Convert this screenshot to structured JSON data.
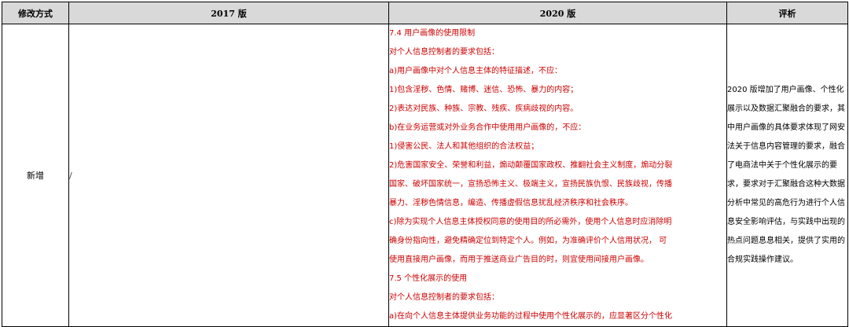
{
  "table": {
    "headers": {
      "method": "修改方式",
      "v2017": "2017 版",
      "v2020": "2020 版",
      "comment": "评析"
    },
    "row": {
      "method": "新增",
      "v2017": "/",
      "v2020_lines": [
        "7.4 用户画像的使用限制",
        "对个人信息控制者的要求包括：",
        "a)用户画像中对个人信息主体的特征描述，不应：",
        "1)包含淫秽、色情、赌博、迷信、恐怖、暴力的内容；",
        "2)表达对民族、种族、宗教、残疾、疾病歧视的内容。",
        "b)在业务运营或对外业务合作中使用用户画像的，不应：",
        "1)侵害公民、法人和其他组织的合法权益；",
        "2)危害国家安全、荣誉和利益，煽动颠覆国家政权、推翻社会主义制度，煽动分裂",
        "国家、破坏国家统一，宣扬恐怖主义、极端主义，宣扬民族仇恨、民族歧视，传播",
        "暴力、淫秽色情信息，编造、传播虚假信息扰乱经济秩序和社会秩序。",
        "c)除为实现个人信息主体授权同意的使用目的所必需外，使用个人信息时应消除明",
        "确身份指向性，避免精确定位到特定个人。例如，为准确评价个人信用状况， 可",
        "使用直接用户画像，而用于推送商业广告目的时，则宜使用间接用户画像。",
        "7.5 个性化展示的使用",
        "对个人信息控制者的要求包括：",
        "a)在向个人信息主体提供业务功能的过程中使用个性化展示的，应显著区分个性化"
      ],
      "comment": "2020 版增加了用户画像、个性化展示以及数据汇聚融合的要求，其中用户画像的具体要求体现了网安法关于信息内容管理的要求，融合了电商法中关于个性化展示的要求，要求对于汇聚融合这种大数据分析中常见的高危行为进行个人信息安全影响评估，与实践中出现的热点问题息息相关，提供了实用的合规实践操作建议。"
    }
  },
  "colors": {
    "header_bg": "#d9d9d9",
    "new_text": "#cc0000",
    "border": "#000000"
  }
}
